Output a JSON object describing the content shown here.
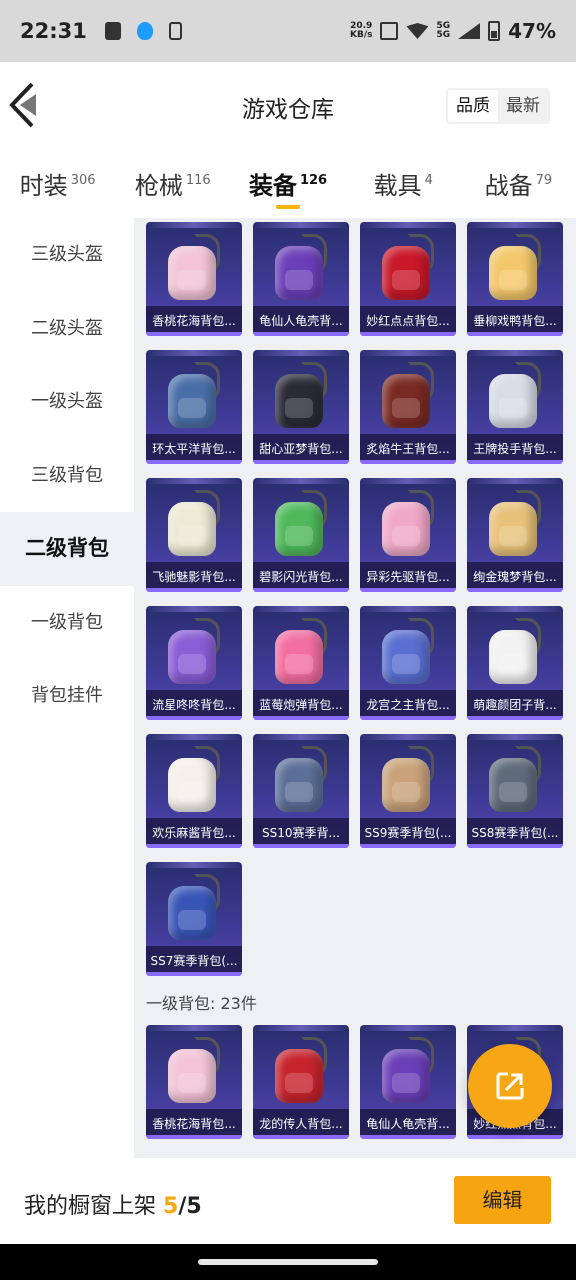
{
  "status_bar": {
    "time": "22:31",
    "net_speed_value": "20.9",
    "net_speed_unit": "KB/s",
    "network": "5G",
    "battery": "47%"
  },
  "header": {
    "title": "游戏仓库",
    "sort_options": [
      "品质",
      "最新"
    ]
  },
  "tabs": [
    {
      "label": "时装",
      "count": "306"
    },
    {
      "label": "枪械",
      "count": "116"
    },
    {
      "label": "装备",
      "count": "126",
      "active": true
    },
    {
      "label": "载具",
      "count": "4"
    },
    {
      "label": "战备",
      "count": "79"
    }
  ],
  "sidebar": {
    "items": [
      "三级头盔",
      "二级头盔",
      "一级头盔",
      "三级背包",
      "二级背包",
      "一级背包",
      "背包挂件"
    ],
    "active": "二级背包"
  },
  "items_level2": [
    {
      "name": "香桃花海背包...",
      "color": "#f3c4d6"
    },
    {
      "name": "龟仙人龟壳背...",
      "color": "#6b3fb8"
    },
    {
      "name": "妙红点点背包...",
      "color": "#c8182a"
    },
    {
      "name": "垂柳戏鸭背包...",
      "color": "#f4c86a"
    },
    {
      "name": "环太平洋背包...",
      "color": "#4a6fa8"
    },
    {
      "name": "甜心亚梦背包...",
      "color": "#2b2b38"
    },
    {
      "name": "炙焰牛王背包...",
      "color": "#7a2a24"
    },
    {
      "name": "王牌投手背包...",
      "color": "#d8dce6"
    },
    {
      "name": "飞驰魅影背包...",
      "color": "#ecebd6"
    },
    {
      "name": "碧影闪光背包...",
      "color": "#4fb85a"
    },
    {
      "name": "异彩先驱背包...",
      "color": "#f0a8c8"
    },
    {
      "name": "绚金瑰梦背包...",
      "color": "#e8c27a"
    },
    {
      "name": "流星咚咚背包...",
      "color": "#8a5cd6"
    },
    {
      "name": "蓝莓炮弹背包...",
      "color": "#f26fa0"
    },
    {
      "name": "龙宫之主背包...",
      "color": "#5a6fd0"
    },
    {
      "name": "萌趣颜团子背...",
      "color": "#f2f2f2"
    },
    {
      "name": "欢乐麻酱背包...",
      "color": "#f5f1ea"
    },
    {
      "name": "SS10赛季背...",
      "color": "#5b6f98"
    },
    {
      "name": "SS9赛季背包(...",
      "color": "#c9a27a"
    },
    {
      "name": "SS8赛季背包(...",
      "color": "#5f6b7a"
    },
    {
      "name": "SS7赛季背包(...",
      "color": "#3856b8"
    }
  ],
  "section_level1": {
    "label": "一级背包: 23件"
  },
  "items_level1": [
    {
      "name": "香桃花海背包...",
      "color": "#f3c4d6"
    },
    {
      "name": "龙的传人背包...",
      "color": "#c7242e"
    },
    {
      "name": "龟仙人龟壳背...",
      "color": "#6b3fb8"
    },
    {
      "name": "妙红点点背包...",
      "color": "#c8182a"
    }
  ],
  "bottom_bar": {
    "text": "我的橱窗上架",
    "count_current": "5",
    "count_sep": "/",
    "count_total": "5",
    "edit_label": "编辑"
  },
  "colors": {
    "accent": "#f5a80f",
    "card_bg": "#3e3a94"
  },
  "icons": {
    "back": "back-arrow-icon",
    "fab": "share-arrow-icon"
  }
}
